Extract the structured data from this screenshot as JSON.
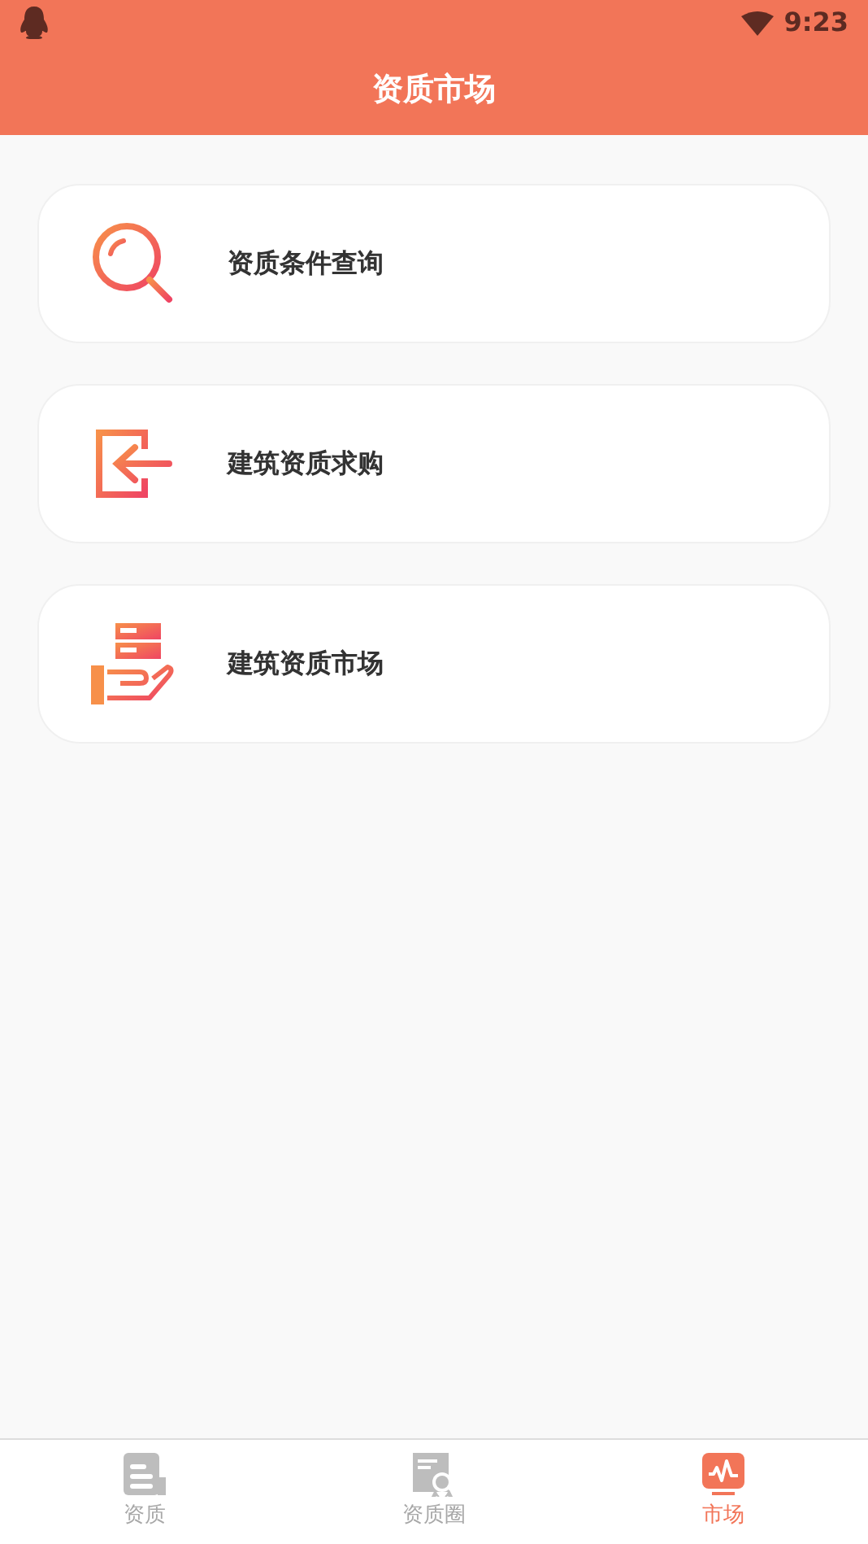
{
  "status_bar": {
    "time": "9:23"
  },
  "header": {
    "title": "资质市场"
  },
  "menu": [
    {
      "kind": "search",
      "label": "资质条件查询"
    },
    {
      "kind": "enter",
      "label": "建筑资质求购"
    },
    {
      "kind": "market",
      "label": "建筑资质市场"
    }
  ],
  "tab_bar": [
    {
      "kind": "doc",
      "label": "资质",
      "selected": false
    },
    {
      "kind": "cert",
      "label": "资质圈",
      "selected": false
    },
    {
      "kind": "chart",
      "label": "市场",
      "selected": true
    }
  ]
}
